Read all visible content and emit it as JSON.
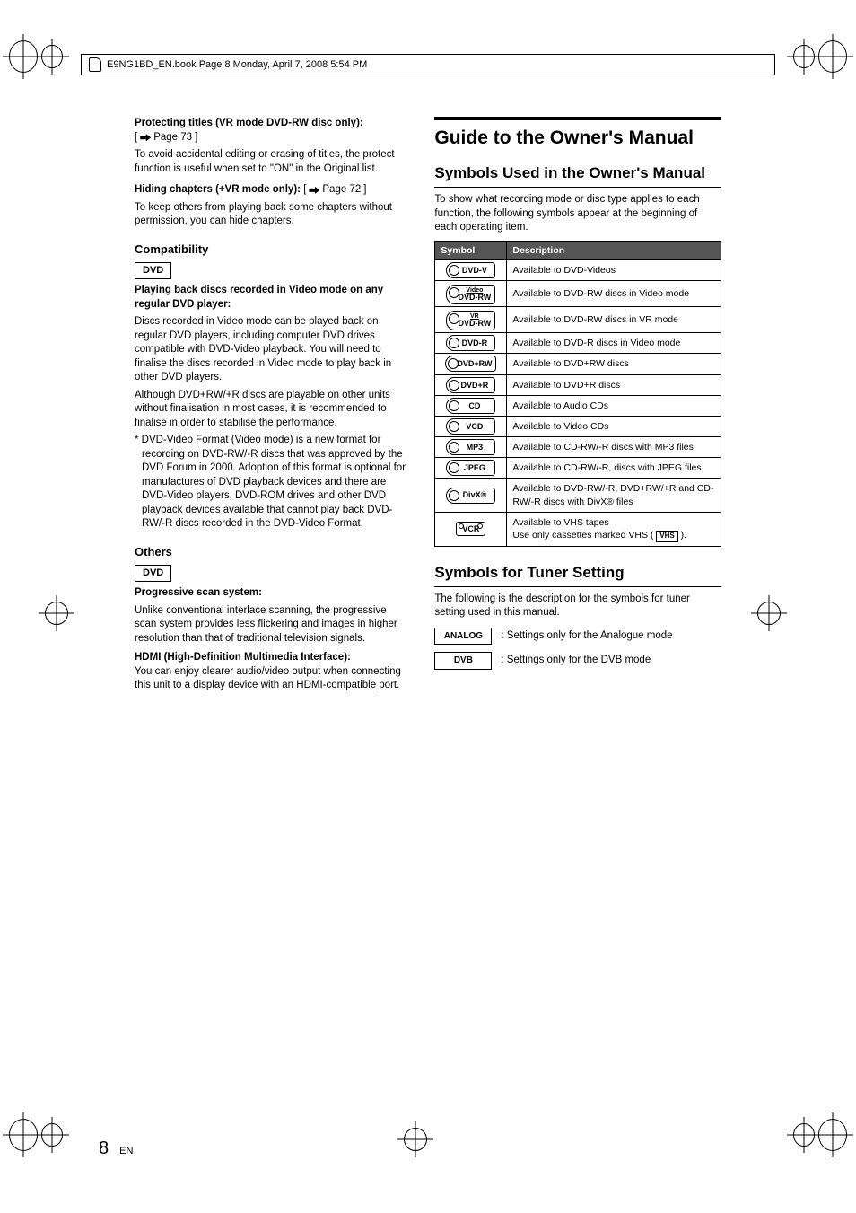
{
  "header": "E9NG1BD_EN.book  Page 8  Monday, April 7, 2008  5:54 PM",
  "left": {
    "protect_title": "Protecting titles (VR mode DVD-RW disc only):",
    "protect_ref": "Page 73",
    "protect_body": "To avoid accidental editing or erasing of titles, the protect function is useful when set to \"ON\" in the Original list.",
    "hiding_title": "Hiding chapters (+VR mode only):",
    "hiding_ref": "Page 72",
    "hiding_body": "To keep others from playing back some chapters without permission, you can hide chapters.",
    "compat_h": "Compatibility",
    "dvd_badge": "DVD",
    "compat_sub": "Playing back discs recorded in Video mode on any regular DVD player:",
    "compat_p1": "Discs recorded in Video mode can be played back on regular DVD players, including computer DVD drives compatible with DVD-Video playback. You will need to finalise the discs recorded in Video mode to play back in other DVD players.",
    "compat_p2": "Although DVD+RW/+R discs are playable on other units without finalisation in most cases, it is recommended to finalise in order to stabilise the performance.",
    "compat_note": "* DVD-Video Format (Video mode) is a new format for recording on DVD-RW/-R discs that was approved by the DVD Forum in 2000. Adoption of this format is optional for manufactures of DVD playback devices and there are DVD-Video players, DVD-ROM drives and other DVD playback devices available that cannot play back DVD-RW/-R discs recorded in the DVD-Video Format.",
    "others_h": "Others",
    "prog_title": "Progressive scan system:",
    "prog_body": "Unlike conventional interlace scanning, the progressive scan system provides less flickering and images in higher resolution than that of traditional television signals.",
    "hdmi_title": "HDMI (High-Definition Multimedia Interface):",
    "hdmi_body": "You can enjoy clearer audio/video output when connecting this unit to a display device with an HDMI-compatible port."
  },
  "right": {
    "main_h": "Guide to the Owner's Manual",
    "sub1_h": "Symbols Used in the Owner's Manual",
    "sub1_intro": "To show what recording mode or disc type applies to each function, the following symbols appear at the beginning of each operating item.",
    "th_symbol": "Symbol",
    "th_desc": "Description",
    "rows": [
      {
        "label": "DVD-V",
        "desc": "Available to DVD-Videos"
      },
      {
        "label_top": "Video",
        "label_bot": "DVD-RW",
        "desc": "Available to DVD-RW discs in Video mode"
      },
      {
        "label_top": "VR",
        "label_bot": "DVD-RW",
        "desc": "Available to DVD-RW discs in VR mode"
      },
      {
        "label": "DVD-R",
        "desc": "Available to DVD-R discs in Video mode"
      },
      {
        "label": "DVD+RW",
        "desc": "Available to DVD+RW discs"
      },
      {
        "label": "DVD+R",
        "desc": "Available to DVD+R discs"
      },
      {
        "label": "CD",
        "desc": "Available to Audio CDs"
      },
      {
        "label": "VCD",
        "desc": "Available to Video CDs"
      },
      {
        "label": "MP3",
        "desc": "Available to CD-RW/-R discs with MP3 files"
      },
      {
        "label": "JPEG",
        "desc": "Available to CD-RW/-R, discs with JPEG files"
      },
      {
        "label": "DivX®",
        "desc": "Available to DVD-RW/-R, DVD+RW/+R and CD-RW/-R discs with DivX® files"
      },
      {
        "label": "VCR",
        "vcr": true,
        "desc_prefix": "Available to VHS tapes",
        "desc_suffix_a": "Use only cassettes marked VHS (",
        "desc_suffix_b": ").",
        "vhs_box": "VHS"
      }
    ],
    "sub2_h": "Symbols for Tuner Setting",
    "sub2_intro": "The following is the description for the symbols for tuner setting used in this manual.",
    "tuner": [
      {
        "badge": "ANALOG",
        "text": ": Settings only for the Analogue mode"
      },
      {
        "badge": "DVB",
        "text": ": Settings only for the DVB mode"
      }
    ]
  },
  "page_number": "8",
  "page_lang": "EN"
}
